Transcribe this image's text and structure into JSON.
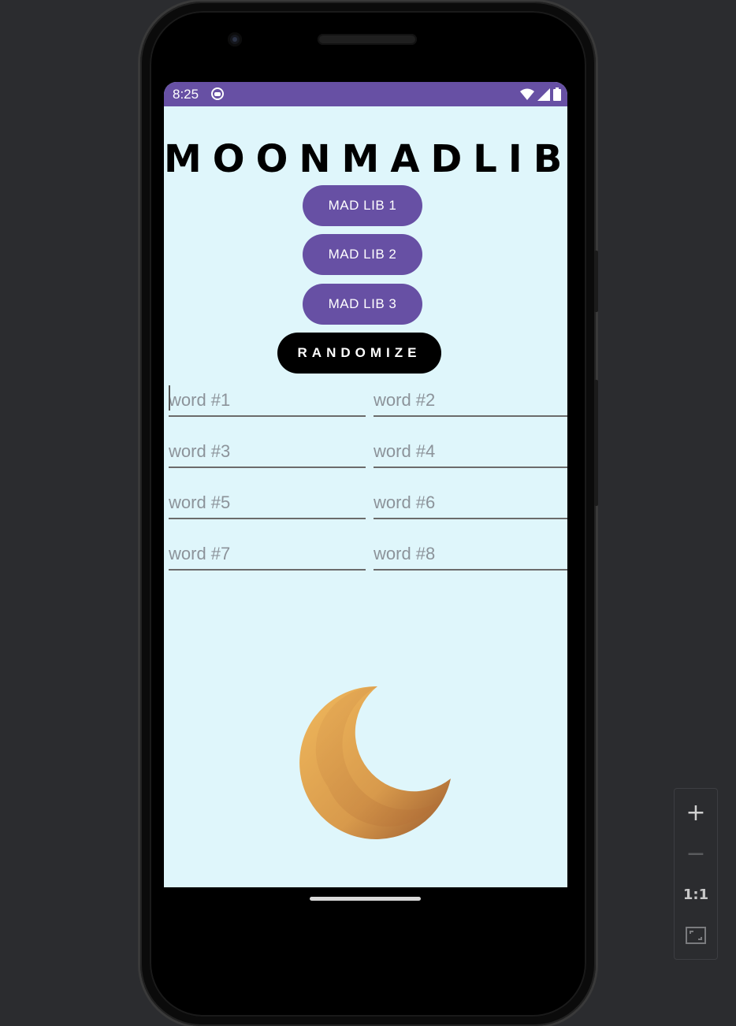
{
  "status_bar": {
    "time": "8:25",
    "app_icon": "android-debug-icon",
    "wifi_icon": "wifi-icon",
    "signal_icon": "cell-signal-icon",
    "battery_icon": "battery-icon",
    "color": "#6750a4"
  },
  "app": {
    "title": "MOONMADLIB",
    "background": "#dff6fb",
    "buttons": [
      {
        "label": "MAD LIB 1"
      },
      {
        "label": "MAD LIB 2"
      },
      {
        "label": "MAD LIB 3"
      }
    ],
    "randomize_label": "RANDOMIZE",
    "fields": [
      {
        "placeholder": "word #1",
        "value": ""
      },
      {
        "placeholder": "word #2",
        "value": ""
      },
      {
        "placeholder": "word #3",
        "value": ""
      },
      {
        "placeholder": "word #4",
        "value": ""
      },
      {
        "placeholder": "word #5",
        "value": ""
      },
      {
        "placeholder": "word #6",
        "value": ""
      },
      {
        "placeholder": "word #7",
        "value": ""
      },
      {
        "placeholder": "word #8",
        "value": ""
      }
    ],
    "image": "crescent-moon-icon",
    "accent_color": "#6750a4"
  },
  "emulator_controls": {
    "zoom_in": "+",
    "zoom_out": "−",
    "actual_size": "1:1",
    "fit_icon": "fit-screen-icon"
  }
}
